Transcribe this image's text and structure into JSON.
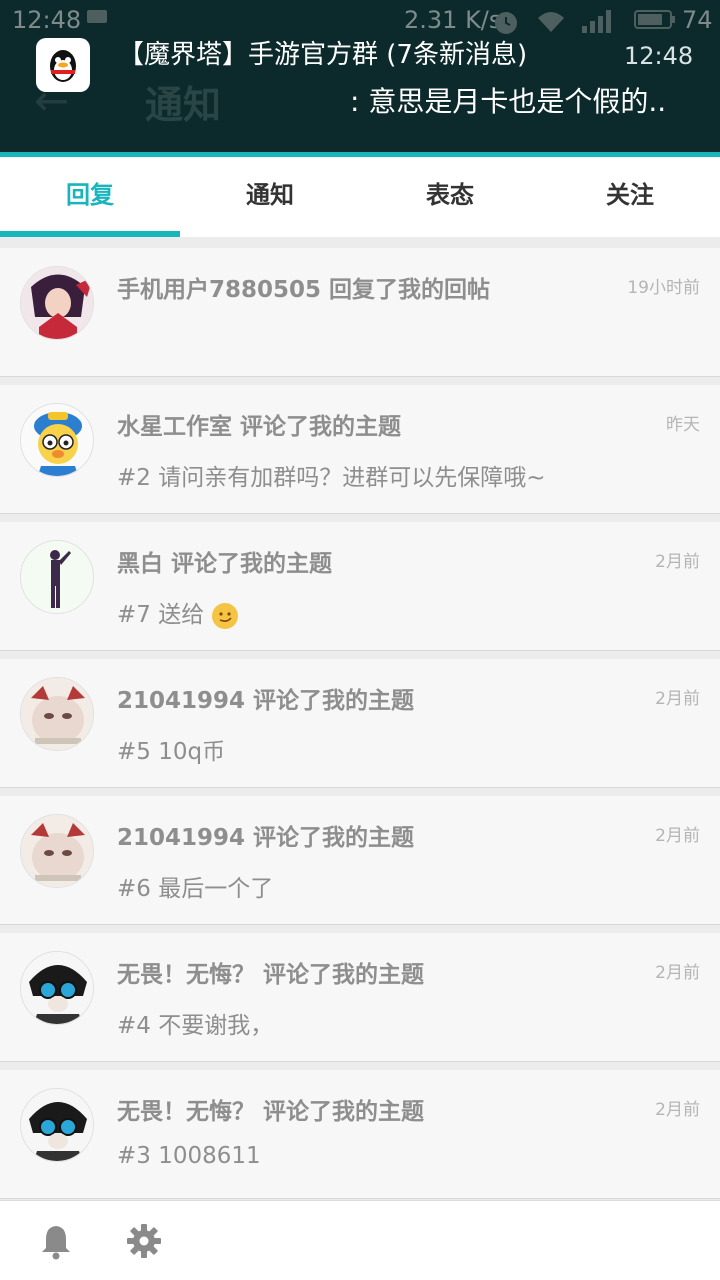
{
  "status_bar": {
    "time": "12:48",
    "network_speed": "2.31 K/s",
    "battery": "74"
  },
  "header": {
    "back_icon": "back-arrow-icon",
    "title": "通知"
  },
  "notification": {
    "app_icon": "qq-penguin-icon",
    "title": "【魔界塔】手游官方群 (7条新消息)",
    "time": "12:48",
    "text": ": 意思是月卡也是个假的.."
  },
  "tabs": [
    {
      "label": "回复",
      "active": true
    },
    {
      "label": "通知",
      "active": false
    },
    {
      "label": "表态",
      "active": false
    },
    {
      "label": "关注",
      "active": false
    }
  ],
  "items": [
    {
      "title": "手机用户7880505 回复了我的回帖",
      "time": "19小时前",
      "body": ""
    },
    {
      "title": "水星工作室 评论了我的主题",
      "time": "昨天",
      "body": "#2 请问亲有加群吗？进群可以先保障哦~"
    },
    {
      "title": "黑白 评论了我的主题",
      "time": "2月前",
      "body": "#7 送给"
    },
    {
      "title": "21041994 评论了我的主题",
      "time": "2月前",
      "body": "#5 10q币"
    },
    {
      "title": "21041994 评论了我的主题",
      "time": "2月前",
      "body": "#6 最后一个了"
    },
    {
      "title": "无畏！无悔？ 评论了我的主题",
      "time": "2月前",
      "body": "#4 不要谢我，"
    },
    {
      "title": "无畏！无悔？ 评论了我的主题",
      "time": "2月前",
      "body": "#3 1008611"
    }
  ],
  "bottom_bar": {
    "icons": [
      "bell-icon",
      "gear-icon"
    ]
  },
  "colors": {
    "accent": "#19b5bd",
    "header_bg": "#0c2a2c"
  }
}
